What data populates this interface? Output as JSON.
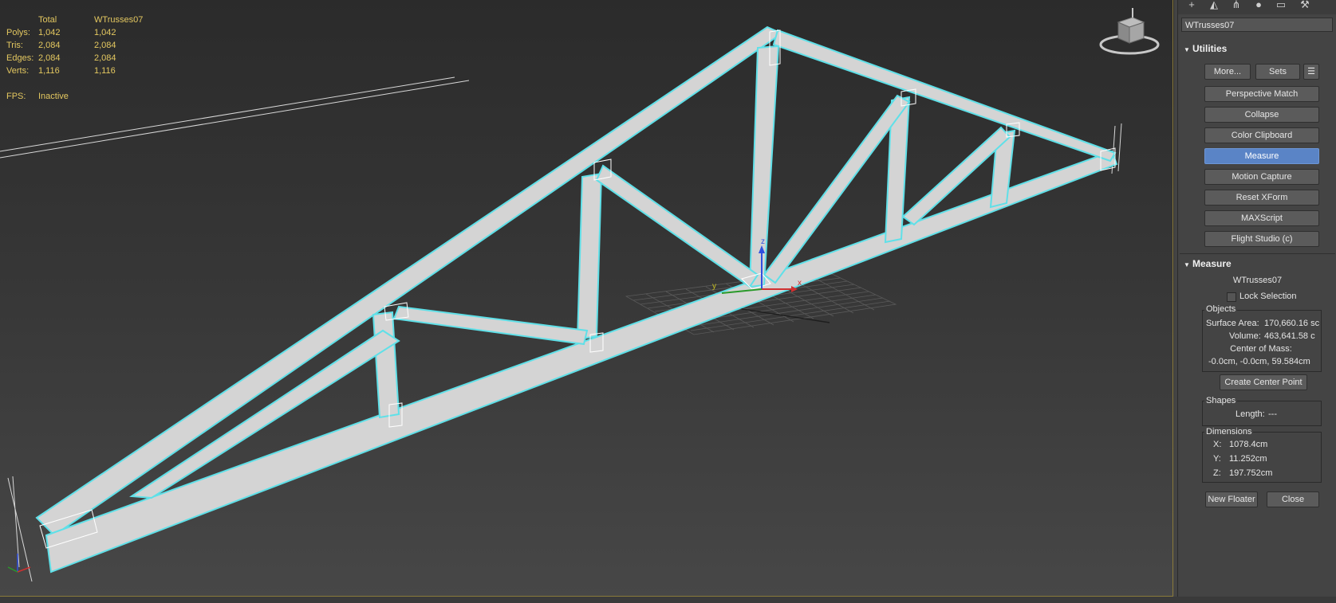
{
  "stats": {
    "header": {
      "blank": "",
      "total": "Total",
      "selected": "WTrusses07"
    },
    "rows": [
      {
        "label": "Polys:",
        "total": "1,042",
        "selected": "1,042"
      },
      {
        "label": "Tris:",
        "total": "2,084",
        "selected": "2,084"
      },
      {
        "label": "Edges:",
        "total": "2,084",
        "selected": "2,084"
      },
      {
        "label": "Verts:",
        "total": "1,116",
        "selected": "1,116"
      }
    ],
    "fps_label": "FPS:",
    "fps_value": "Inactive"
  },
  "colors": {
    "selection_outline": "#5fe0e8",
    "truss_fill": "#d4d4d4",
    "active_button": "#5a84c6",
    "stats_text": "#e4c860",
    "axis_x": "#d03030",
    "axis_y": "#c8c020",
    "axis_z": "#3050e0"
  },
  "toolbar_icons": [
    "create-icon",
    "modify-icon",
    "hierarchy-icon",
    "motion-icon",
    "display-icon",
    "utilities-icon"
  ],
  "object_name": "WTrusses07",
  "utilities": {
    "title": "Utilities",
    "more": "More...",
    "sets": "Sets",
    "buttons": [
      "Perspective Match",
      "Collapse",
      "Color Clipboard",
      "Measure",
      "Motion Capture",
      "Reset XForm",
      "MAXScript",
      "Flight Studio (c)"
    ],
    "active": "Measure"
  },
  "measure": {
    "title": "Measure",
    "object_name": "WTrusses07",
    "lock_selection": "Lock Selection",
    "objects_group": "Objects",
    "surface_area_label": "Surface Area:",
    "surface_area_value": "170,660.16 sc",
    "volume_label": "Volume:",
    "volume_value": "463,641.58 c",
    "center_of_mass_label": "Center of Mass:",
    "center_of_mass_value": "-0.0cm, -0.0cm, 59.584cm",
    "create_center_point": "Create Center Point",
    "shapes_group": "Shapes",
    "length_label": "Length:",
    "length_value": "---",
    "dimensions_group": "Dimensions",
    "dims": [
      {
        "axis": "X:",
        "value": "1078.4cm"
      },
      {
        "axis": "Y:",
        "value": "11.252cm"
      },
      {
        "axis": "Z:",
        "value": "197.752cm"
      }
    ],
    "new_floater": "New Floater",
    "close": "Close"
  },
  "gizmo_labels": {
    "x": "x",
    "y": "y",
    "z": "z"
  }
}
